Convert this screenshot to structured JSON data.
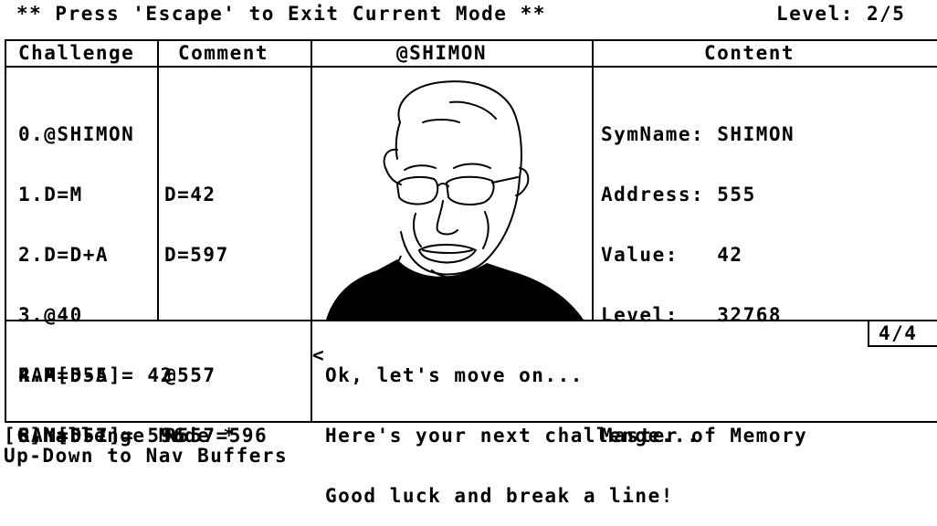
{
  "header": {
    "mode_hint": "** Press 'Escape' to Exit Current Mode **",
    "level_label": "Level: 2/5"
  },
  "columns": {
    "challenge": "Challenge",
    "comment": "Comment",
    "portrait": "@SHIMON",
    "content": "Content"
  },
  "challenge_lines": [
    "0.@SHIMON",
    "1.D=M",
    "2.D=D+A",
    "3.@40",
    "4.A=D-A",
    "5.M=D-1"
  ],
  "comment_lines": [
    "",
    "D=42",
    "D=597",
    "",
    "@557",
    "R557=596"
  ],
  "content": {
    "symname": "SymName: SHIMON",
    "address": "Address: 555",
    "value": "Value:   42",
    "level": "Level:   32768",
    "title": "Master of Memory"
  },
  "ram_lines": [
    "RAM[555]= 42",
    "RAM[557]= 596"
  ],
  "dialog": {
    "lines": [
      "Ok, let's move on...",
      "Here's your next challenge...",
      "Good luck and break a line!"
    ],
    "cursor": "<",
    "page": "4/4"
  },
  "footer": {
    "mode": "[C]hallenge Mode *",
    "nav_hint": "Up-Down to Nav Buffers"
  }
}
